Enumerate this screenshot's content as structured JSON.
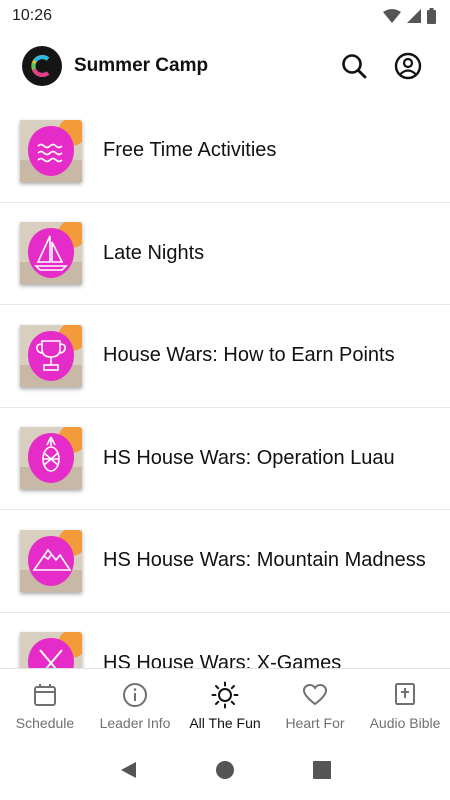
{
  "status_bar": {
    "time": "10:26"
  },
  "app_bar": {
    "title": "Summer Camp",
    "logo_icon": "camp-logo-icon",
    "actions": [
      "search-icon",
      "account-circle-icon"
    ]
  },
  "list": {
    "items": [
      {
        "title": "Free Time Activities",
        "icon": "waves-icon"
      },
      {
        "title": "Late Nights",
        "icon": "sailboat-icon"
      },
      {
        "title": "House Wars: How to Earn Points",
        "icon": "trophy-icon"
      },
      {
        "title": "HS House Wars: Operation Luau",
        "icon": "pineapple-icon"
      },
      {
        "title": "HS House Wars: Mountain Madness",
        "icon": "mountain-icon"
      },
      {
        "title": "HS House Wars: X-Games",
        "icon": "x-icon"
      }
    ]
  },
  "bottom_nav": {
    "items": [
      {
        "label": "Schedule",
        "icon": "calendar-icon"
      },
      {
        "label": "Leader Info",
        "icon": "info-icon"
      },
      {
        "label": "All The Fun",
        "icon": "sun-icon",
        "active": true
      },
      {
        "label": "Heart For",
        "icon": "heart-icon"
      },
      {
        "label": "Audio Bible",
        "icon": "bible-icon"
      }
    ]
  },
  "colors": {
    "accent_pink": "#e62cc8",
    "thumb_orange": "#f39a3a",
    "active": "#111111",
    "inactive": "#707070"
  }
}
